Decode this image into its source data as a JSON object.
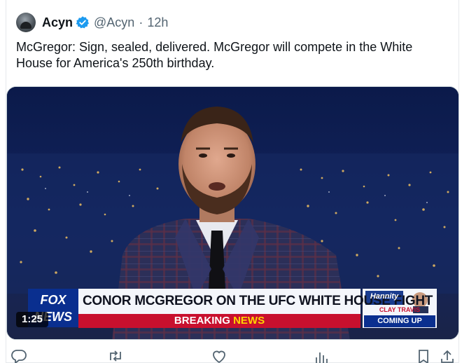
{
  "tweet": {
    "display_name": "Acyn",
    "handle": "@Acyn",
    "separator": "·",
    "time": "12h",
    "text": "McGregor: Sign, sealed, delivered. McGregor will compete in the White House for America's 250th birthday."
  },
  "video": {
    "duration": "1:25",
    "chyron": {
      "network": "FOX NEWS",
      "headline": "CONOR MCGREGOR ON THE UFC WHITE HOUSE FIGHT",
      "banner_part1": "BREAKING",
      "banner_part2": "NEWS",
      "show_logo": "Hannity",
      "upnext_line1": "CLAY TRAVIS",
      "upnext_line2": "COMING UP"
    }
  },
  "actions": [
    {
      "icon": "reply-icon"
    },
    {
      "icon": "retweet-icon"
    },
    {
      "icon": "like-icon"
    },
    {
      "icon": "views-icon"
    },
    {
      "icon": "bookmark-icon"
    },
    {
      "icon": "share-icon"
    }
  ],
  "colors": {
    "verified": "#1d9bf0",
    "text": "#0f1419",
    "muted": "#536471",
    "breaking_red": "#c8102e",
    "fox_blue": "#0a2f8f"
  }
}
